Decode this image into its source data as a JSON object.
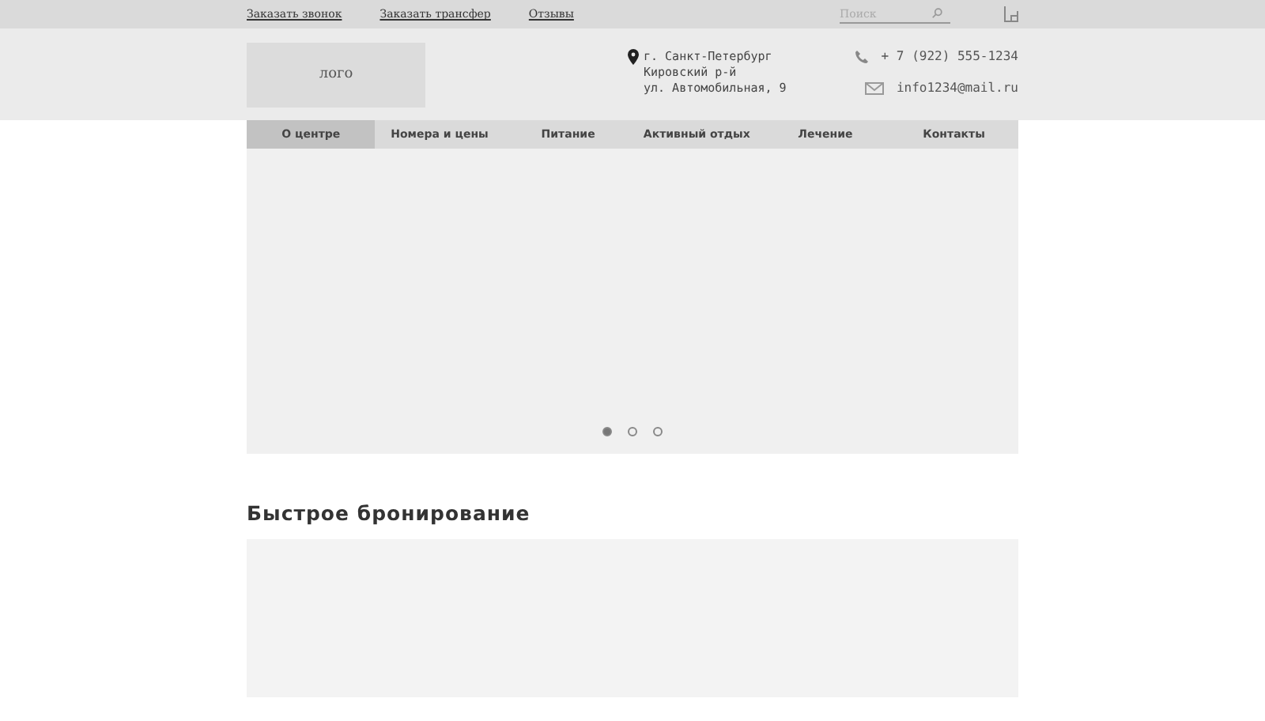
{
  "top_links": [
    "Заказать звонок",
    "Заказать трансфер",
    "Отзывы"
  ],
  "search": {
    "placeholder": "Поиск"
  },
  "logo": "лого",
  "address": [
    "г. Санкт-Петербург",
    "Кировский р-й",
    "ул. Автомобильная, 9"
  ],
  "phone": "+ 7 (922) 555-1234",
  "email": "info1234@mail.ru",
  "nav": [
    {
      "label": "О центре",
      "selected": true
    },
    {
      "label": "Номера и цены",
      "selected": false
    },
    {
      "label": "Питание",
      "selected": false
    },
    {
      "label": "Активный отдых",
      "selected": false
    },
    {
      "label": "Лечение",
      "selected": false
    },
    {
      "label": "Контакты",
      "selected": false
    }
  ],
  "slider_dots": [
    {
      "selected": true
    },
    {
      "selected": false
    },
    {
      "selected": false
    }
  ],
  "booking_title": "Быстрое бронирование"
}
